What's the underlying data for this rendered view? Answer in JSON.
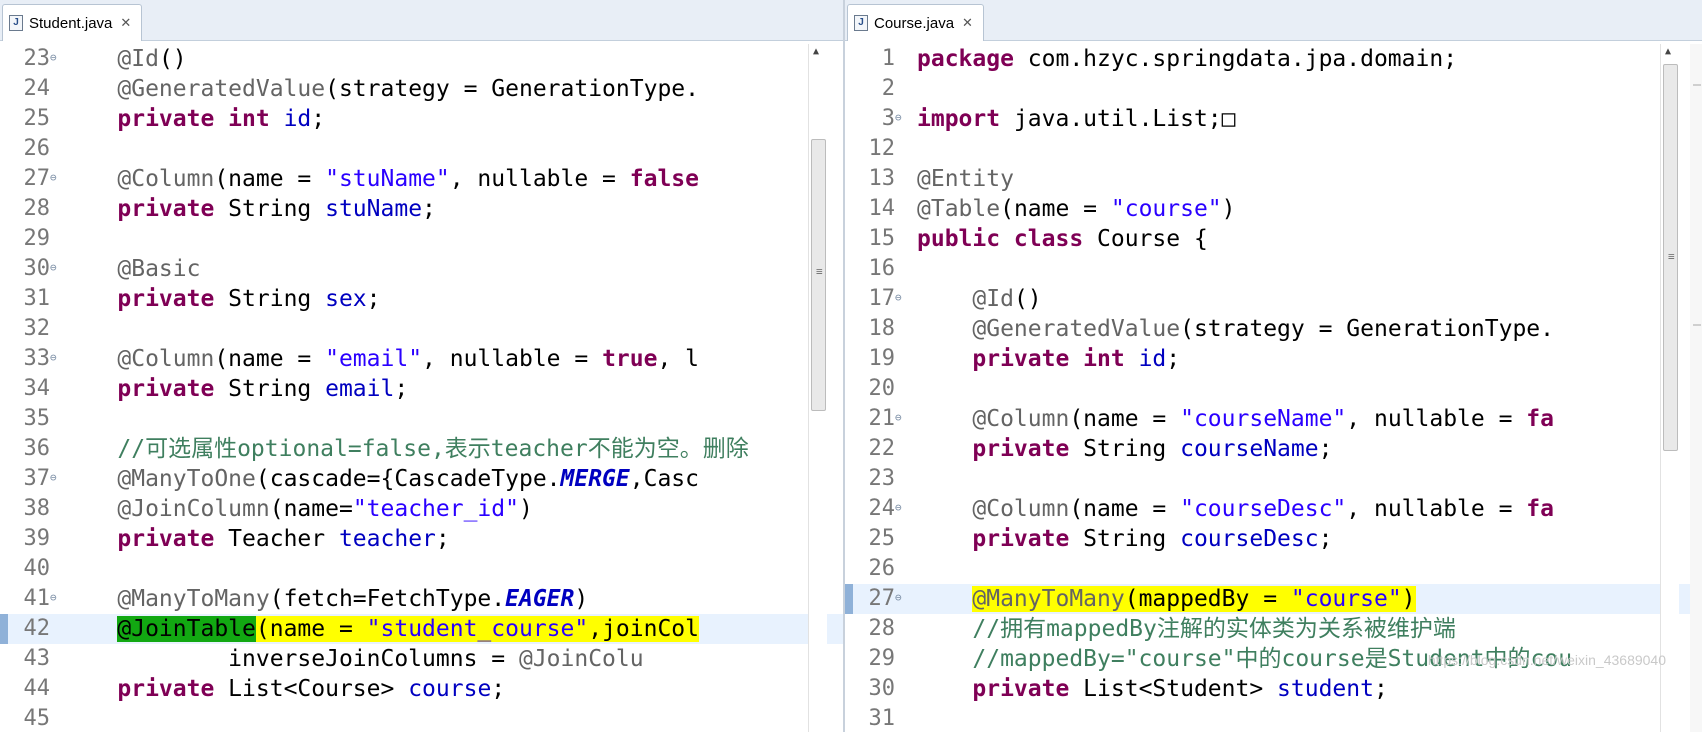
{
  "left_editor": {
    "tab_title": "Student.java",
    "lines": [
      {
        "n": "23",
        "fold": true,
        "segs": [
          {
            "t": "    "
          },
          {
            "t": "@Id",
            "c": "ann"
          },
          {
            "t": "()"
          }
        ]
      },
      {
        "n": "24",
        "segs": [
          {
            "t": "    "
          },
          {
            "t": "@GeneratedValue",
            "c": "ann"
          },
          {
            "t": "(strategy = GenerationType."
          }
        ]
      },
      {
        "n": "25",
        "segs": [
          {
            "t": "    "
          },
          {
            "t": "private int",
            "c": "kw"
          },
          {
            "t": " "
          },
          {
            "t": "id",
            "c": "fld"
          },
          {
            "t": ";"
          }
        ]
      },
      {
        "n": "26",
        "segs": []
      },
      {
        "n": "27",
        "fold": true,
        "segs": [
          {
            "t": "    "
          },
          {
            "t": "@Column",
            "c": "ann"
          },
          {
            "t": "(name = "
          },
          {
            "t": "\"stuName\"",
            "c": "str"
          },
          {
            "t": ", nullable = "
          },
          {
            "t": "false",
            "c": "kw"
          }
        ]
      },
      {
        "n": "28",
        "segs": [
          {
            "t": "    "
          },
          {
            "t": "private",
            "c": "kw"
          },
          {
            "t": " String "
          },
          {
            "t": "stuName",
            "c": "fld"
          },
          {
            "t": ";"
          }
        ]
      },
      {
        "n": "29",
        "segs": []
      },
      {
        "n": "30",
        "fold": true,
        "segs": [
          {
            "t": "    "
          },
          {
            "t": "@Basic",
            "c": "ann"
          }
        ]
      },
      {
        "n": "31",
        "segs": [
          {
            "t": "    "
          },
          {
            "t": "private",
            "c": "kw"
          },
          {
            "t": " String "
          },
          {
            "t": "sex",
            "c": "fld"
          },
          {
            "t": ";"
          }
        ]
      },
      {
        "n": "32",
        "segs": []
      },
      {
        "n": "33",
        "fold": true,
        "segs": [
          {
            "t": "    "
          },
          {
            "t": "@Column",
            "c": "ann"
          },
          {
            "t": "(name = "
          },
          {
            "t": "\"email\"",
            "c": "str"
          },
          {
            "t": ", nullable = "
          },
          {
            "t": "true",
            "c": "kw"
          },
          {
            "t": ", l"
          }
        ]
      },
      {
        "n": "34",
        "segs": [
          {
            "t": "    "
          },
          {
            "t": "private",
            "c": "kw"
          },
          {
            "t": " String "
          },
          {
            "t": "email",
            "c": "fld"
          },
          {
            "t": ";"
          }
        ]
      },
      {
        "n": "35",
        "segs": []
      },
      {
        "n": "36",
        "segs": [
          {
            "t": "    "
          },
          {
            "t": "//可选属性optional=false,表示teacher不能为空。删除",
            "c": "cm"
          }
        ]
      },
      {
        "n": "37",
        "fold": true,
        "segs": [
          {
            "t": "    "
          },
          {
            "t": "@ManyToOne",
            "c": "ann"
          },
          {
            "t": "(cascade={CascadeType."
          },
          {
            "t": "MERGE",
            "c": "enum"
          },
          {
            "t": ",Casc"
          }
        ]
      },
      {
        "n": "38",
        "segs": [
          {
            "t": "    "
          },
          {
            "t": "@JoinColumn",
            "c": "ann"
          },
          {
            "t": "(name="
          },
          {
            "t": "\"teacher_id\"",
            "c": "str"
          },
          {
            "t": ")"
          }
        ]
      },
      {
        "n": "39",
        "segs": [
          {
            "t": "    "
          },
          {
            "t": "private",
            "c": "kw"
          },
          {
            "t": " Teacher "
          },
          {
            "t": "teacher",
            "c": "fld"
          },
          {
            "t": ";"
          }
        ]
      },
      {
        "n": "40",
        "segs": []
      },
      {
        "n": "41",
        "fold": true,
        "segs": [
          {
            "t": "    "
          },
          {
            "t": "@ManyToMany",
            "c": "ann"
          },
          {
            "t": "(fetch=FetchType."
          },
          {
            "t": "EAGER",
            "c": "enum"
          },
          {
            "t": ")"
          }
        ]
      },
      {
        "n": "42",
        "current": true,
        "segs": [
          {
            "t": "    "
          },
          {
            "t": "@JoinTable",
            "c": "ann hl-green"
          },
          {
            "t": "(name = ",
            "c": "hl"
          },
          {
            "t": "\"student_course\"",
            "c": "str hl"
          },
          {
            "t": ",joinCol",
            "c": "hl"
          }
        ]
      },
      {
        "n": "43",
        "segs": [
          {
            "t": "            inverseJoinColumns = "
          },
          {
            "t": "@JoinColu",
            "c": "ann"
          }
        ]
      },
      {
        "n": "44",
        "segs": [
          {
            "t": "    "
          },
          {
            "t": "private",
            "c": "kw"
          },
          {
            "t": " List<Course> "
          },
          {
            "t": "course",
            "c": "fld"
          },
          {
            "t": ";"
          }
        ]
      },
      {
        "n": "45",
        "segs": []
      }
    ]
  },
  "right_editor": {
    "tab_title": "Course.java",
    "lines": [
      {
        "n": "1",
        "segs": [
          {
            "t": "package",
            "c": "kw"
          },
          {
            "t": " com.hzyc.springdata.jpa.domain;"
          }
        ]
      },
      {
        "n": "2",
        "segs": []
      },
      {
        "n": "3",
        "fold": true,
        "segs": [
          {
            "t": "import",
            "c": "kw"
          },
          {
            "t": " java.util.List;"
          },
          {
            "t": "□"
          }
        ]
      },
      {
        "n": "12",
        "segs": []
      },
      {
        "n": "13",
        "segs": [
          {
            "t": "@Entity",
            "c": "ann"
          }
        ]
      },
      {
        "n": "14",
        "segs": [
          {
            "t": "@Table",
            "c": "ann"
          },
          {
            "t": "(name = "
          },
          {
            "t": "\"course\"",
            "c": "str"
          },
          {
            "t": ")"
          }
        ]
      },
      {
        "n": "15",
        "segs": [
          {
            "t": "public class",
            "c": "kw"
          },
          {
            "t": " Course {"
          }
        ]
      },
      {
        "n": "16",
        "segs": []
      },
      {
        "n": "17",
        "fold": true,
        "segs": [
          {
            "t": "    "
          },
          {
            "t": "@Id",
            "c": "ann"
          },
          {
            "t": "()"
          }
        ]
      },
      {
        "n": "18",
        "segs": [
          {
            "t": "    "
          },
          {
            "t": "@GeneratedValue",
            "c": "ann"
          },
          {
            "t": "(strategy = GenerationType."
          }
        ]
      },
      {
        "n": "19",
        "segs": [
          {
            "t": "    "
          },
          {
            "t": "private int",
            "c": "kw"
          },
          {
            "t": " "
          },
          {
            "t": "id",
            "c": "fld"
          },
          {
            "t": ";"
          }
        ]
      },
      {
        "n": "20",
        "segs": []
      },
      {
        "n": "21",
        "fold": true,
        "segs": [
          {
            "t": "    "
          },
          {
            "t": "@Column",
            "c": "ann"
          },
          {
            "t": "(name = "
          },
          {
            "t": "\"courseName\"",
            "c": "str"
          },
          {
            "t": ", nullable = "
          },
          {
            "t": "fa",
            "c": "kw"
          }
        ]
      },
      {
        "n": "22",
        "segs": [
          {
            "t": "    "
          },
          {
            "t": "private",
            "c": "kw"
          },
          {
            "t": " String "
          },
          {
            "t": "courseName",
            "c": "fld"
          },
          {
            "t": ";"
          }
        ]
      },
      {
        "n": "23",
        "segs": []
      },
      {
        "n": "24",
        "fold": true,
        "segs": [
          {
            "t": "    "
          },
          {
            "t": "@Column",
            "c": "ann"
          },
          {
            "t": "(name = "
          },
          {
            "t": "\"courseDesc\"",
            "c": "str"
          },
          {
            "t": ", nullable = "
          },
          {
            "t": "fa",
            "c": "kw"
          }
        ]
      },
      {
        "n": "25",
        "segs": [
          {
            "t": "    "
          },
          {
            "t": "private",
            "c": "kw"
          },
          {
            "t": " String "
          },
          {
            "t": "courseDesc",
            "c": "fld"
          },
          {
            "t": ";"
          }
        ]
      },
      {
        "n": "26",
        "segs": []
      },
      {
        "n": "27",
        "fold": true,
        "current": true,
        "segs": [
          {
            "t": "    "
          },
          {
            "t": "@ManyToMany",
            "c": "ann hl"
          },
          {
            "t": "(mappedBy = ",
            "c": "hl"
          },
          {
            "t": "\"course\"",
            "c": "str hl"
          },
          {
            "t": ")",
            "c": "hl"
          }
        ]
      },
      {
        "n": "28",
        "segs": [
          {
            "t": "    "
          },
          {
            "t": "//拥有mappedBy注解的实体类为关系被维护端",
            "c": "cm"
          }
        ]
      },
      {
        "n": "29",
        "segs": [
          {
            "t": "    "
          },
          {
            "t": "//mappedBy=\"course\"中的course是Student中的cou",
            "c": "cm"
          }
        ]
      },
      {
        "n": "30",
        "segs": [
          {
            "t": "    "
          },
          {
            "t": "private",
            "c": "kw"
          },
          {
            "t": " List<Student> "
          },
          {
            "t": "student",
            "c": "fld"
          },
          {
            "t": ";"
          }
        ]
      },
      {
        "n": "31",
        "segs": []
      }
    ]
  },
  "watermark": "https://blog.csdn.net/weixin_43689040",
  "icons": {
    "file": "java-file-icon",
    "close": "close-icon"
  }
}
